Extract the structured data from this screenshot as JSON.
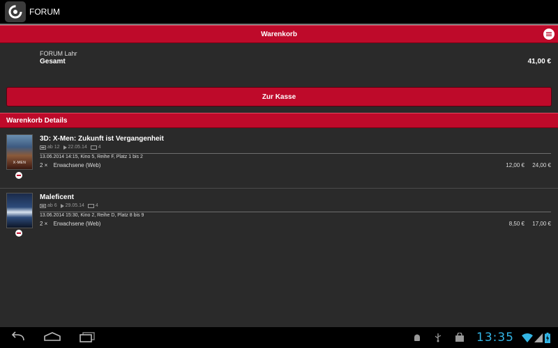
{
  "app": {
    "title": "FORUM",
    "icon": "forum-logo-icon"
  },
  "cart": {
    "header_title": "Warenkorb",
    "menu_icon": "overflow-menu-icon",
    "cinema": "FORUM Lahr",
    "total_label": "Gesamt",
    "total_value": "41,00 €",
    "checkout_label": "Zur Kasse"
  },
  "details": {
    "header_title": "Warenkorb Details",
    "items": [
      {
        "title": "3D: X-Men: Zukunft ist Vergangenheit",
        "poster_text": "X-MEN",
        "age": "ab 12",
        "release": "22.05.14",
        "count": "4",
        "show_info": "13.06.2014 14:15, Kino 5, Reihe F, Platz 1 bis 2",
        "qty": "2 ×",
        "ticket_type": "Erwachsene (Web)",
        "unit_price": "12,00 €",
        "total_price": "24,00 €"
      },
      {
        "title": "Maleficent",
        "poster_text": "",
        "age": "ab 6",
        "release": "29.05.14",
        "count": "4",
        "show_info": "13.06.2014 15:30, Kino 2, Reihe D, Platz 8 bis 9",
        "qty": "2 ×",
        "ticket_type": "Erwachsene (Web)",
        "unit_price": "8,50 €",
        "total_price": "17,00 €"
      }
    ]
  },
  "system": {
    "clock": "13:35",
    "nav": [
      "back-icon",
      "home-icon",
      "recent-apps-icon"
    ],
    "status_icons": [
      "android-debug-icon",
      "usb-icon",
      "shopping-bag-icon",
      "wifi-icon",
      "signal-icon",
      "battery-charging-icon"
    ]
  },
  "colors": {
    "accent": "#be0a2a",
    "clock": "#33b5e5",
    "background": "#2a2a2a"
  }
}
